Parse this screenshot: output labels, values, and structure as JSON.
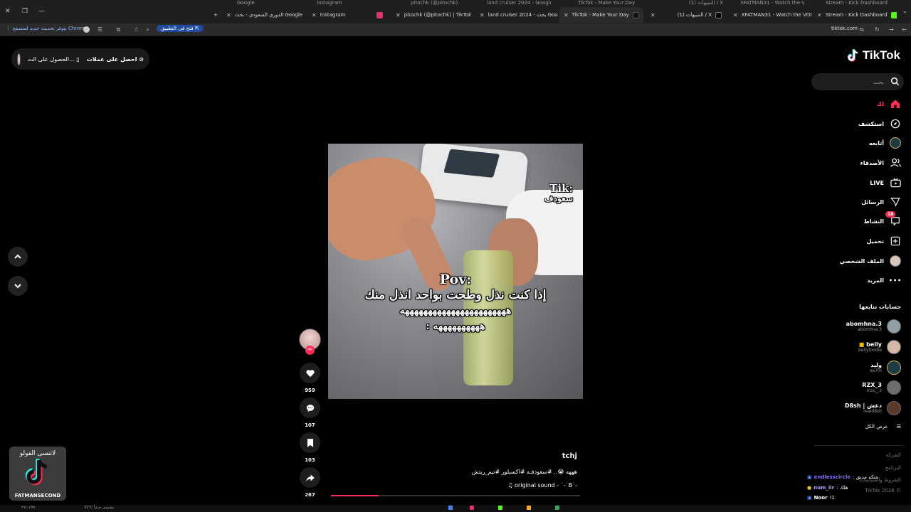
{
  "browser": {
    "tabs_faded": [
      "Google",
      "Instagram",
      "pitochk (@pitochk)",
      "land cruiser 2024 - Google",
      "TikTok - Make Your Day",
      "(1) التنبيهات / X",
      "XFATMAN31 - Watch the VOD",
      "Stream - Kick Dashboard"
    ],
    "tabs": [
      {
        "title": "الدوري السعودي - بحث Google",
        "color": "#4285f4"
      },
      {
        "title": "Instagram",
        "color": "#e1306c"
      },
      {
        "title": "pitochk (@pitochk) | TikTok",
        "color": "#111111"
      },
      {
        "title": "land cruiser 2024 - بحث Google",
        "color": "#4285f4"
      },
      {
        "title": "TikTok - Make Your Day",
        "color": "#111111"
      },
      {
        "title": "(1) التنبيهات / X",
        "color": "#000000"
      },
      {
        "title": "XFATMAN31 - Watch the VOD",
        "color": "#53fc18"
      },
      {
        "title": "Stream - Kick Dashboard",
        "color": "#53fc18"
      }
    ],
    "new_tab": "+",
    "update_notice": "يتوفر تحديث جديد لمتصفح Chrome",
    "open_in_app": "فتح في التطبيق",
    "url": "tiktok.com"
  },
  "topbar": {
    "get_coins": "احصل على عملات",
    "get_app": "الحصول على الت..."
  },
  "sidebar": {
    "logo": "TikTok",
    "search_placeholder": "بحث",
    "nav": [
      {
        "label": "لك",
        "icon": "home-icon"
      },
      {
        "label": "استكشف",
        "icon": "compass-icon"
      },
      {
        "label": "أتابعه",
        "icon": "following-icon"
      },
      {
        "label": "الأصدقاء",
        "icon": "friends-icon"
      },
      {
        "label": "LIVE",
        "icon": "live-icon"
      },
      {
        "label": "الرسائل",
        "icon": "messages-icon"
      },
      {
        "label": "النشاط",
        "icon": "activity-icon",
        "badge": "18"
      },
      {
        "label": "تحميل",
        "icon": "upload-icon"
      },
      {
        "label": "الملف الشخصي",
        "icon": "profile-icon"
      },
      {
        "label": "المزيد",
        "icon": "more-icon"
      }
    ],
    "following_title": "حسابات تتابعها",
    "following": [
      {
        "name": "abomhna.3",
        "handle": "abomhna.3",
        "color": "#8fa0a8"
      },
      {
        "name": "belly",
        "handle": "bellyfoodie",
        "color": "#d6b7a8"
      },
      {
        "name": "وليد",
        "handle": "ex7m",
        "color": "#1c3b44"
      },
      {
        "name": "RZX_3",
        "handle": "rrzx__3",
        "color": "#6c6c6c"
      },
      {
        "name": "D8sh | دغش",
        "handle": "reald8sh",
        "color": "#5a3a2a"
      }
    ],
    "see_all": "عرض الكل",
    "footer": [
      "الشركة",
      "البرنامج",
      "الشروط والسياسات",
      "TikTok 2026 ©"
    ]
  },
  "chat": [
    {
      "user": "endlesscircle",
      "msg": ": متكه مديق",
      "color": "#8a6cff"
    },
    {
      "user": "num_iir",
      "msg": ": هلك",
      "color": "#b4a7ff"
    },
    {
      "user": "Noor",
      "msg": "!1",
      "color": "#ffffff"
    }
  ],
  "video": {
    "watermark_line1": "Tik:",
    "watermark_line2": "سعودف",
    "caption": [
      "Pov:",
      "إذا كنت نذل وطحت بواحد انذل منك",
      "هههههههههههههههههههههههه",
      ": ههههههههههه"
    ],
    "creator": "tchj",
    "description": "هههه 😭.. #سعودفـه #اكسبلور #تيم_ريتش",
    "sound": "♫ original sound - ˙-˙B˙-",
    "progress": 0.19
  },
  "actions": {
    "likes": "959",
    "comments": "107",
    "saves": "103",
    "shares": "267"
  },
  "overlay": {
    "text": "لاتنسى الفولو",
    "channel": "FATMANSECOND"
  },
  "taskbar": {
    "date": "٢٦/٠١/٢٧",
    "temp": "33°C مشمس جزئياً"
  }
}
